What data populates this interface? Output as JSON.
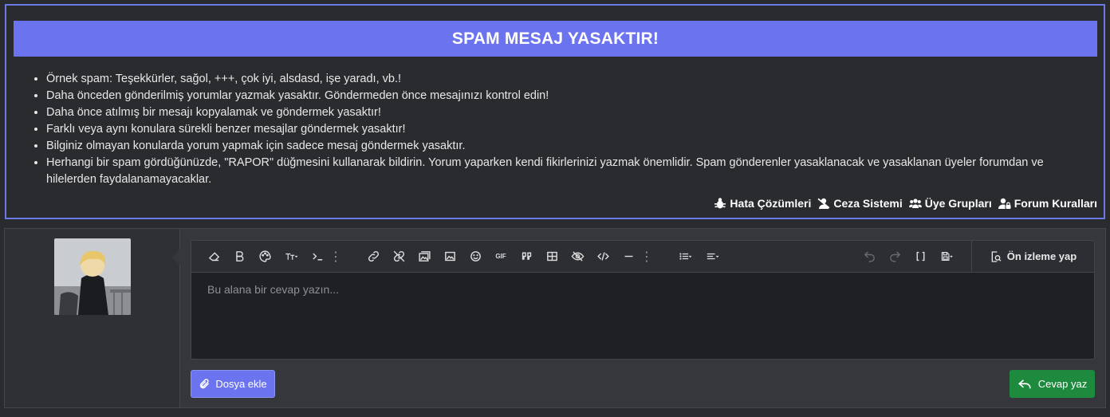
{
  "notice": {
    "title": "SPAM MESAJ YASAKTIR!",
    "rules": [
      "Örnek spam: Teşekkürler, sağol, +++, çok iyi, alsdasd, işe yaradı, vb.!",
      "Daha önceden gönderilmiş yorumlar yazmak yasaktır. Göndermeden önce mesajınızı kontrol edin!",
      "Daha önce atılmış bir mesajı kopyalamak ve göndermek yasaktır!",
      "Farklı veya aynı konulara sürekli benzer mesajlar göndermek yasaktır!",
      "Bilginiz olmayan konularda yorum yapmak için sadece mesaj göndermek yasaktır.",
      "Herhangi bir spam gördüğünüzde, \"RAPOR\" düğmesini kullanarak bildirin. Yorum yaparken kendi fikirlerinizi yazmak önemlidir. Spam gönderenler yasaklanacak ve yasaklanan üyeler forumdan ve hilelerden faydalanamayacaklar."
    ],
    "links": [
      {
        "label": "Hata Çözümleri",
        "icon": "bug-icon"
      },
      {
        "label": "Ceza Sistemi",
        "icon": "user-slash-icon"
      },
      {
        "label": "Üye Grupları",
        "icon": "users-icon"
      },
      {
        "label": "Forum Kuralları",
        "icon": "user-lock-icon"
      }
    ]
  },
  "colors": {
    "accent": "#6b74ee",
    "submit": "#1d8a3e",
    "background": "#2a2b2f"
  },
  "editor": {
    "placeholder": "Bu alana bir cevap yazın...",
    "preview_label": "Ön izleme yap"
  },
  "actions": {
    "attach_label": "Dosya ekle",
    "submit_label": "Cevap yaz"
  }
}
